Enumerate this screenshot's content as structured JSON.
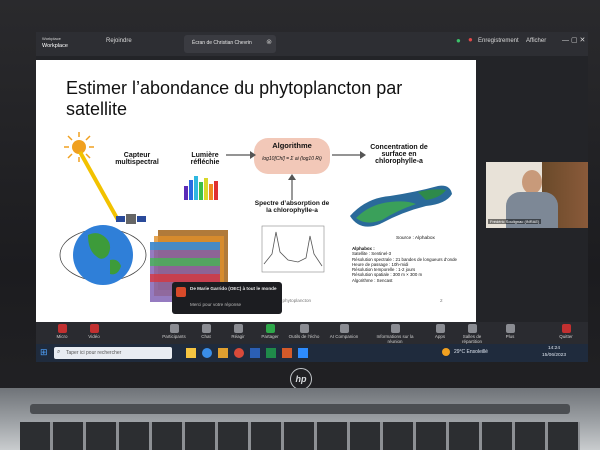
{
  "topbar": {
    "app_line1": "Workplace",
    "app_line2": "Workplace",
    "tab_label": "Écran de Christian Chevrin",
    "status_dot": "Enregistrement",
    "view_label": "Afficher",
    "left_label": "Rejoindre"
  },
  "slide": {
    "title": "Estimer l’abondance du phytoplancton par satellite",
    "sensor": "Capteur multispectral",
    "light": "Lumière réfléchie",
    "algorithm": "Algorithme",
    "formula": "log10[Chl] = Σ ai (log10 Ri)",
    "spectrum": "Spectre d’absorption de la chlorophylle-a",
    "concentration": "Concentration de surface en chlorophylle-a",
    "source": "Source : Alphabox",
    "details_title": "Alphabox :",
    "details": [
      "Satellite : Sentinel-3",
      "Résolution spectrale : 21 bandes de longueurs d’onde",
      "Heure de passage : 10h-midi",
      "Résolution temporelle : 1-2 jours",
      "Résolution spatiale : 300 m × 300 m",
      "Algorithme : Sencast"
    ],
    "footer": "Microscopies du phytoplancton",
    "page_num": "2"
  },
  "video": {
    "caption": "Frédéric Soulignac (INRAE)"
  },
  "chat_popup": {
    "from": "De Marie Garrido (OEC) à tout le monde",
    "text": "Merci pour votre réponse"
  },
  "toolbar": {
    "items": [
      "Micro",
      "Vidéo",
      "Participants",
      "Chat",
      "Réagir",
      "Partager",
      "Outils de l’écho",
      "AI Companion",
      "Informations sur la réunion",
      "Apps",
      "Salles de répartition",
      "Plus",
      "Quitter"
    ],
    "participant_count": "32"
  },
  "taskbar": {
    "search": "Taper ici pour rechercher",
    "weather": "29°C Ensoleillé",
    "time": "14:24",
    "date": "15/06/2023"
  },
  "brand": "hp"
}
